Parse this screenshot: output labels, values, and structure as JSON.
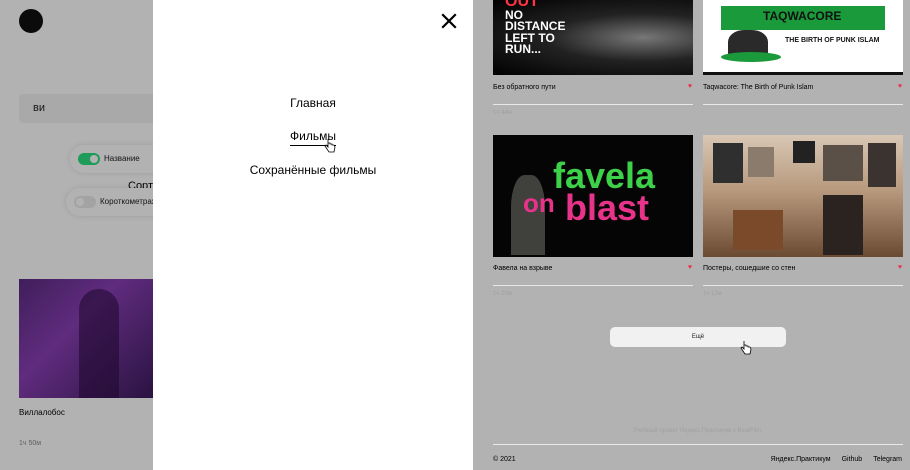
{
  "search": {
    "value": "ви"
  },
  "filters": {
    "name_label": "Название",
    "short_label": "Короткометраж",
    "sort_label": "Сорт"
  },
  "left_card": {
    "title": "Виллалобос",
    "duration": "1ч 50м"
  },
  "menu": {
    "items": [
      {
        "label": "Главная",
        "active": false
      },
      {
        "label": "Фильмы",
        "active": true
      },
      {
        "label": "Сохранённые фильмы",
        "active": false
      }
    ]
  },
  "cards": [
    {
      "title": "Без обратного пути",
      "duration": "1ч 44м",
      "thumb_text": "NO DISTANCE LEFT TO RUN...",
      "thumb_top": "OUT"
    },
    {
      "title": "Taqwacore: The Birth of Punk Islam",
      "duration": "",
      "thumb_text": "TAQWACORE",
      "thumb_sub": "THE BIRTH OF PUNK ISLAM"
    },
    {
      "title": "Фавела на взрыве",
      "duration": "1ч 20м",
      "thumb_w1": "favela",
      "thumb_w2": "on",
      "thumb_w3": "blast"
    },
    {
      "title": "Постеры, сошедшие со стен",
      "duration": "1ч 12м"
    }
  ],
  "more_button": {
    "label": "Ещё"
  },
  "footer": {
    "note": "Учебный проект Яндекс.Практикум х BeatFilm.",
    "copyright": "© 2021",
    "links": [
      "Яндекс.Практикум",
      "Github",
      "Telegram"
    ]
  },
  "colors": {
    "accent_green": "#2be080",
    "heart_red": "#f0304b"
  }
}
